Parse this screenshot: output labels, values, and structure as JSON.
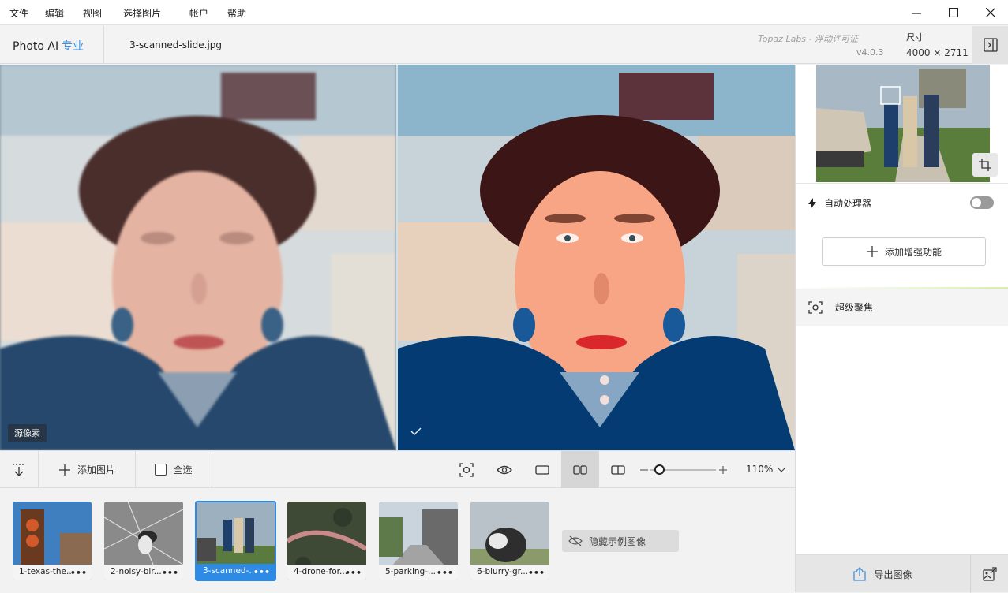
{
  "menu": [
    "文件",
    "编辑",
    "视图",
    "选择图片",
    "帐户",
    "帮助"
  ],
  "header": {
    "app_name": "Photo AI",
    "edition": "专业",
    "filename": "3-scanned-slide.jpg",
    "license_text": "Topaz Labs - 浮动许可证",
    "version": "v4.0.3",
    "dimension_label": "尺寸",
    "dimension_value": "4000 × 2711"
  },
  "viewer": {
    "original_label": "源像素"
  },
  "toolbar": {
    "add_image_label": "添加图片",
    "select_all_label": "全选",
    "zoom_value": "110%",
    "zoom_level": 0.15
  },
  "thumbnails": [
    {
      "caption": "1-texas-the...",
      "selected": false
    },
    {
      "caption": "2-noisy-bir...",
      "selected": false
    },
    {
      "caption": "3-scanned-...",
      "selected": true
    },
    {
      "caption": "4-drone-for...",
      "selected": false
    },
    {
      "caption": "5-parking-...",
      "selected": false
    },
    {
      "caption": "6-blurry-gr...",
      "selected": false
    }
  ],
  "thumb_more": "•••",
  "hide_samples_label": "隐藏示例图像",
  "sidebar": {
    "autopilot_label": "自动处理器",
    "autopilot_on": false,
    "add_enhancement_label": "添加增强功能",
    "superfocus_label": "超级聚焦",
    "export_label": "导出图像"
  },
  "colors": {
    "accent": "#2d8be6",
    "brand_pro": "#3a8fe0"
  }
}
